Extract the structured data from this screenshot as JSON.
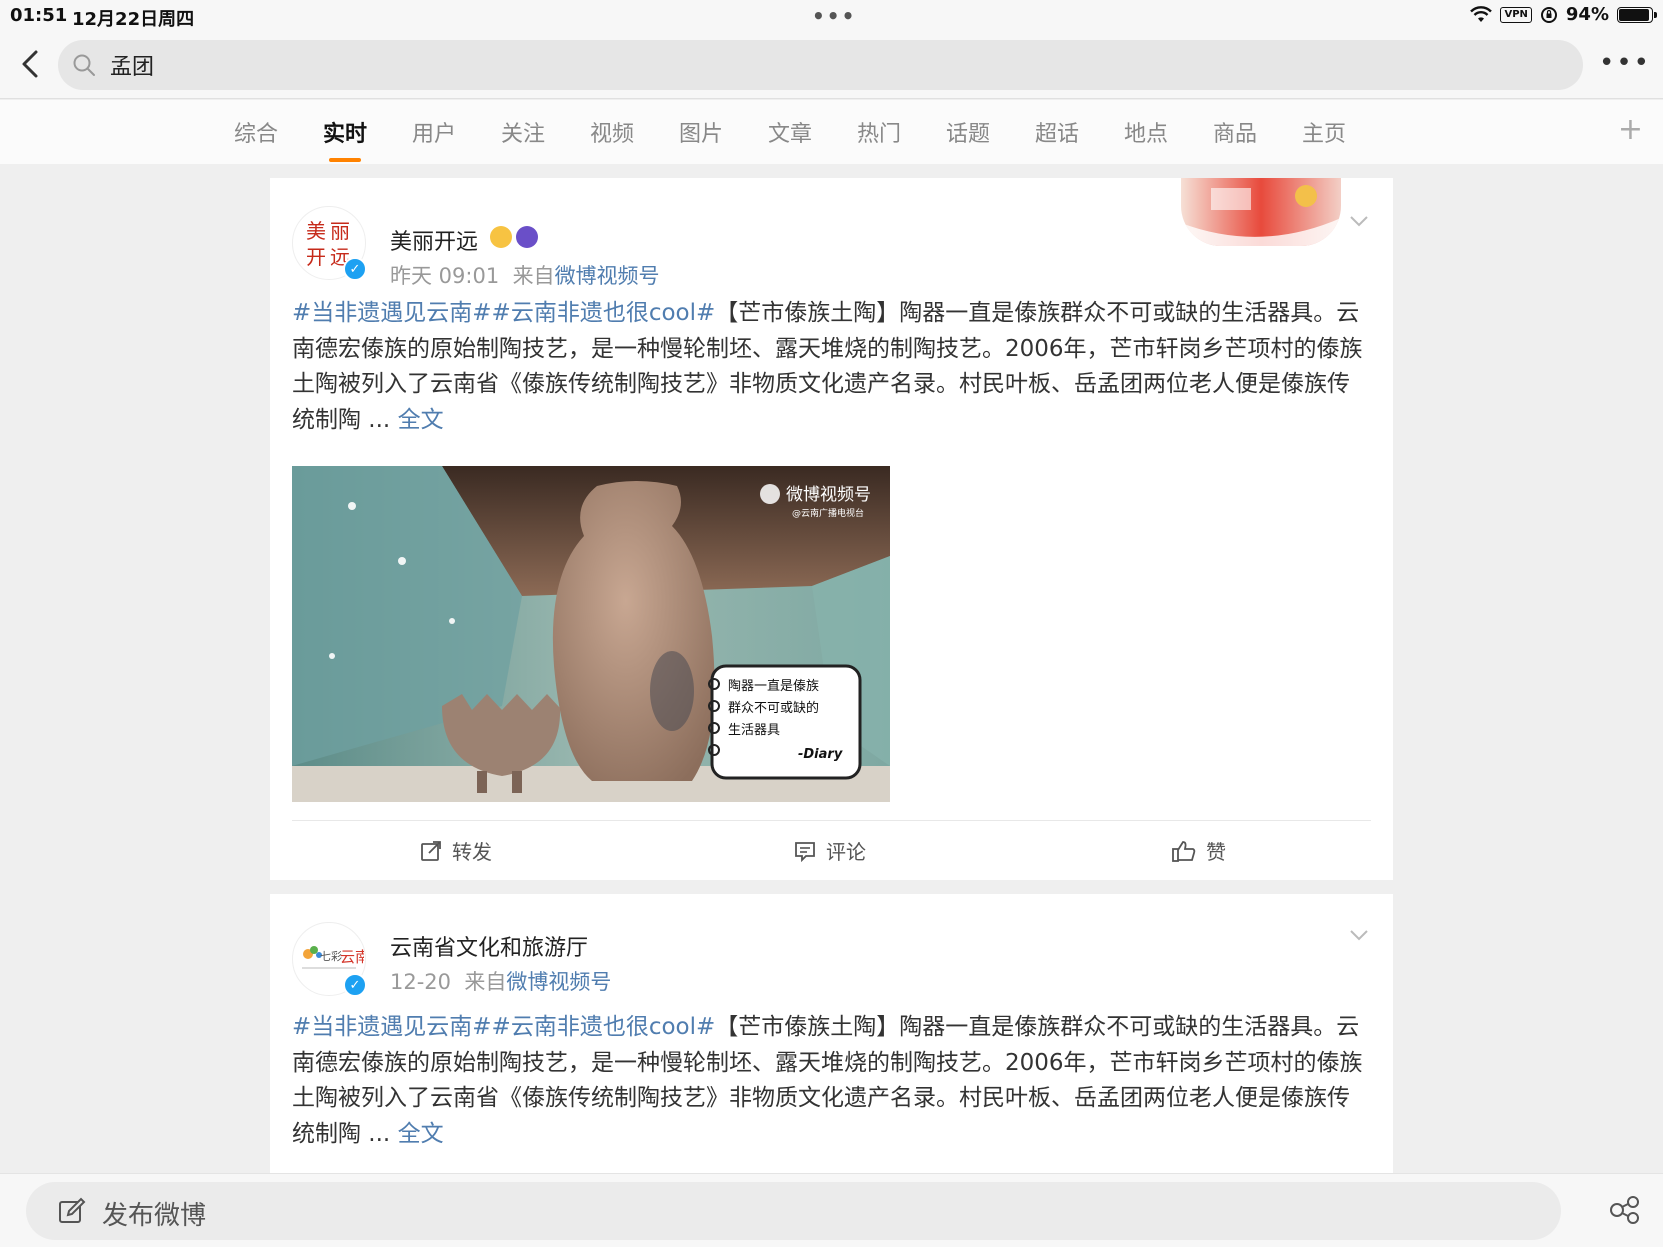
{
  "status_bar": {
    "time": "01:51",
    "date": "12月22日周四",
    "vpn": "VPN",
    "battery": "94%",
    "battery_level": 0.94
  },
  "search": {
    "query": "孟团"
  },
  "tabs": [
    {
      "label": "综合",
      "active": false
    },
    {
      "label": "实时",
      "active": true
    },
    {
      "label": "用户",
      "active": false
    },
    {
      "label": "关注",
      "active": false
    },
    {
      "label": "视频",
      "active": false
    },
    {
      "label": "图片",
      "active": false
    },
    {
      "label": "文章",
      "active": false
    },
    {
      "label": "热门",
      "active": false
    },
    {
      "label": "话题",
      "active": false
    },
    {
      "label": "超话",
      "active": false
    },
    {
      "label": "地点",
      "active": false
    },
    {
      "label": "商品",
      "active": false
    },
    {
      "label": "主页",
      "active": false
    }
  ],
  "posts": [
    {
      "author": "美丽开远",
      "avatar_text": "美丽开远",
      "time": "昨天 09:01",
      "source_prefix": "来自",
      "source": "微博视频号",
      "topic": "#当非遗遇见云南##云南非遗也很cool#",
      "body": "【芒市傣族土陶】陶器一直是傣族群众不可或缺的生活器具。云南德宏傣族的原始制陶技艺，是一种慢轮制坯、露天堆烧的制陶技艺。2006年，芒市轩岗乡芒项村的傣族土陶被列入了云南省《傣族传统制陶技艺》非物质文化遗产名录。村民叶板、岳孟团两位老人便是傣族传统制陶",
      "ellipsis": " ... ",
      "more_label": "全文",
      "video": {
        "watermark": "微博视频号",
        "watermark_sub": "@云南广播电视台",
        "note_lines": [
          "陶器一直是傣族",
          "群众不可或缺的",
          "生活器具"
        ],
        "note_sign": "-Diary"
      },
      "actions": {
        "repost": "转发",
        "comment": "评论",
        "like": "赞"
      }
    },
    {
      "author": "云南省文化和旅游厅",
      "avatar_text": "七彩云南",
      "time": "12-20",
      "source_prefix": "来自",
      "source": "微博视频号",
      "topic": "#当非遗遇见云南##云南非遗也很cool#",
      "body": "【芒市傣族土陶】陶器一直是傣族群众不可或缺的生活器具。云南德宏傣族的原始制陶技艺，是一种慢轮制坯、露天堆烧的制陶技艺。2006年，芒市轩岗乡芒项村的傣族土陶被列入了云南省《傣族传统制陶技艺》非物质文化遗产名录。村民叶板、岳孟团两位老人便是傣族传统制陶",
      "ellipsis": " ... ",
      "more_label": "全文"
    }
  ],
  "bottom_bar": {
    "compose_label": "发布微博"
  },
  "colors": {
    "link": "#507daf",
    "tab_indicator": "#ff8200",
    "verified": "#1da1f2"
  }
}
